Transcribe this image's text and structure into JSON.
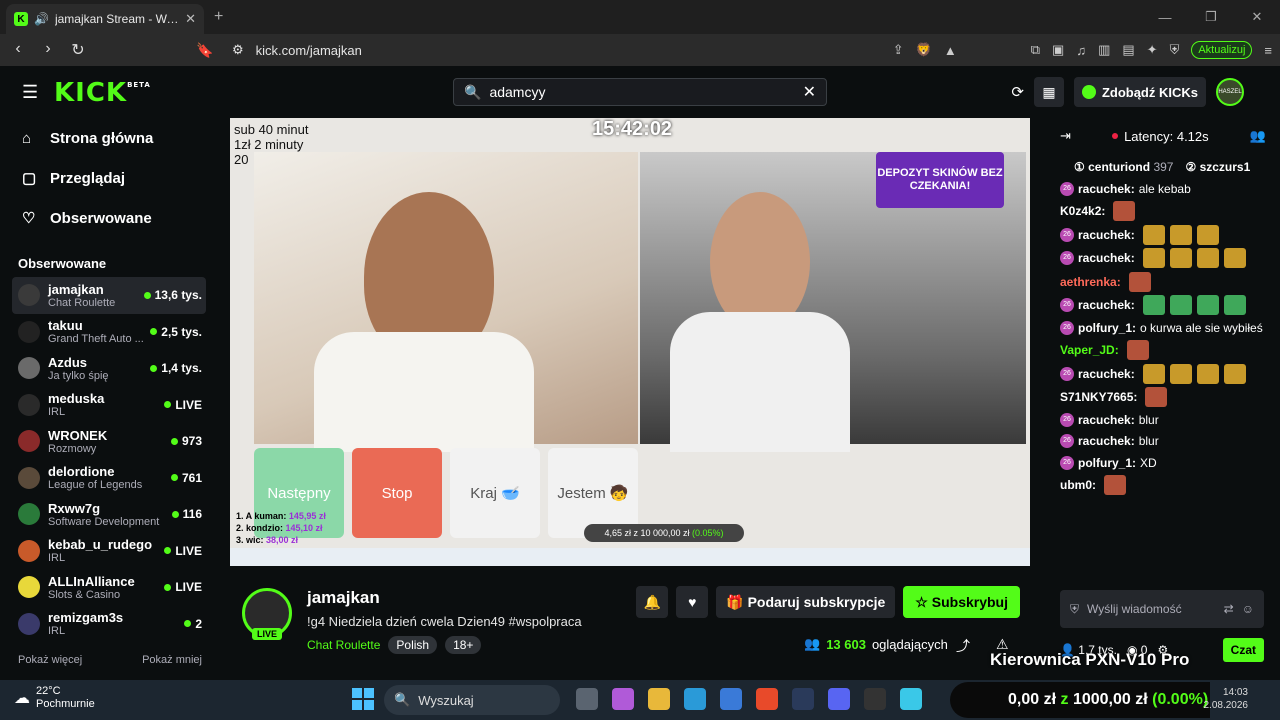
{
  "browser": {
    "tab_title": "jamajkan Stream - Watch Live",
    "url": "kick.com/jamajkan",
    "update_label": "Aktualizuj"
  },
  "header": {
    "logo": "KICK",
    "logo_badge": "BETA",
    "search_value": "adamcyy",
    "kicks_label": "Zdobądź KICKs",
    "avatar_text": "HASZEL"
  },
  "sidebar": {
    "nav": [
      {
        "label": "Strona główna",
        "icon": "home-icon"
      },
      {
        "label": "Przeglądaj",
        "icon": "browse-icon"
      },
      {
        "label": "Obserwowane",
        "icon": "heart-icon"
      }
    ],
    "following_heading": "Obserwowane",
    "channels": [
      {
        "name": "jamajkan",
        "category": "Chat Roulette",
        "viewers": "13,6 tys.",
        "color": "#3a3a3a"
      },
      {
        "name": "takuu",
        "category": "Grand Theft Auto ...",
        "viewers": "2,5 tys.",
        "color": "#222222"
      },
      {
        "name": "Azdus",
        "category": "Ja tylko śpię",
        "viewers": "1,4 tys.",
        "color": "#6a6a6a"
      },
      {
        "name": "meduska",
        "category": "IRL",
        "viewers": "LIVE",
        "color": "#2a2a2a"
      },
      {
        "name": "WRONEK",
        "category": "Rozmowy",
        "viewers": "973",
        "color": "#8a2a2a"
      },
      {
        "name": "delordione",
        "category": "League of Legends",
        "viewers": "761",
        "color": "#5a4a3a"
      },
      {
        "name": "Rxww7g",
        "category": "Software Development",
        "viewers": "116",
        "color": "#2a7a3a"
      },
      {
        "name": "kebab_u_rudego",
        "category": "IRL",
        "viewers": "LIVE",
        "color": "#c85a2a"
      },
      {
        "name": "ALLInAlliance",
        "category": "Slots & Casino",
        "viewers": "LIVE",
        "color": "#e8d83a"
      },
      {
        "name": "remizgam3s",
        "category": "IRL",
        "viewers": "2",
        "color": "#3a3a6a"
      }
    ],
    "show_more": "Pokaż więcej",
    "show_less": "Pokaż mniej"
  },
  "video": {
    "clock": "15:42:02",
    "overlay_lines": [
      "sub 40 minut",
      "1zł 2 minuty",
      "20"
    ],
    "promo": "DEPOZYT SKINÓW BEZ CZEKANIA!",
    "buttons": [
      "Następny",
      "Stop",
      "Kraj 🥣",
      "Jestem 🧒"
    ],
    "donors": [
      {
        "label": "1. A kuman:",
        "amount": "145,95 zł"
      },
      {
        "label": "2. kondzio:",
        "amount": "145,10 zł"
      },
      {
        "label": "3. wic:",
        "amount": "38,00 zł"
      }
    ],
    "goal": "4,65 zł z 10 000,00 zł",
    "goal_pct": "(0.05%)"
  },
  "stream": {
    "live_badge": "LIVE",
    "name": "jamajkan",
    "title": "!g4 Niedziela dzień cwela Dzien49 #wspolpraca",
    "category": "Chat Roulette",
    "tags": [
      "Polish",
      "18+"
    ],
    "gift_label": "Podaruj subskrypcje",
    "subscribe_label": "Subskrybuj",
    "viewers_count": "13 603",
    "viewers_label": "oglądających"
  },
  "chat": {
    "latency": "Latency: 4.12s",
    "leaders": [
      {
        "rank": "1",
        "name": "centuriond",
        "count": "397"
      },
      {
        "rank": "2",
        "name": "szczurs1",
        "count": ""
      }
    ],
    "messages": [
      {
        "badge": true,
        "user": "racuchek",
        "color": "#ffffff",
        "text": "ale kebab",
        "emotes": []
      },
      {
        "badge": false,
        "user": "K0z4k2",
        "color": "#ffffff",
        "text": "",
        "emotes": [
          "r"
        ]
      },
      {
        "badge": true,
        "user": "racuchek",
        "color": "#ffffff",
        "text": "",
        "emotes": [
          "y",
          "y",
          "y"
        ]
      },
      {
        "badge": true,
        "user": "racuchek",
        "color": "#ffffff",
        "text": "",
        "emotes": [
          "y",
          "y",
          "y",
          "y"
        ]
      },
      {
        "badge": false,
        "user": "aethrenka",
        "color": "#ff6a5a",
        "text": "",
        "emotes": [
          "r"
        ]
      },
      {
        "badge": true,
        "user": "racuchek",
        "color": "#ffffff",
        "text": "",
        "emotes": [
          "g",
          "g",
          "g",
          "g"
        ]
      },
      {
        "badge": true,
        "user": "polfury_1",
        "color": "#ffffff",
        "text": "o kurwa ale sie wybiłeś",
        "emotes": []
      },
      {
        "badge": false,
        "user": "Vaper_JD",
        "color": "#53fc18",
        "text": "",
        "emotes": [
          "r"
        ]
      },
      {
        "badge": true,
        "user": "racuchek",
        "color": "#ffffff",
        "text": "",
        "emotes": [
          "y",
          "y",
          "y",
          "y"
        ]
      },
      {
        "badge": false,
        "user": "S71NKY7665",
        "color": "#ffffff",
        "text": "",
        "emotes": [
          "r"
        ]
      },
      {
        "badge": true,
        "user": "racuchek",
        "color": "#ffffff",
        "text": "blur",
        "emotes": []
      },
      {
        "badge": true,
        "user": "racuchek",
        "color": "#ffffff",
        "text": "blur",
        "emotes": []
      },
      {
        "badge": true,
        "user": "polfury_1",
        "color": "#ffffff",
        "text": "XD",
        "emotes": []
      },
      {
        "badge": false,
        "user": "ubm0",
        "color": "#ffffff",
        "text": "",
        "emotes": [
          "r"
        ]
      }
    ],
    "input_placeholder": "Wyślij wiadomość",
    "footer_left": "1,7 tys.",
    "footer_points": "0",
    "send_label": "Czat",
    "overlay_text": "Kierownica PXN-V10 Pro"
  },
  "taskbar": {
    "temp": "22°C",
    "weather": "Pochmurnie",
    "search_label": "Wyszukaj",
    "money_left": "0,00 zł",
    "money_mid": "z",
    "money_right": "1000,00 zł",
    "money_pct": "(0.00%)",
    "time": "14:03",
    "date": "2.08.2026"
  }
}
